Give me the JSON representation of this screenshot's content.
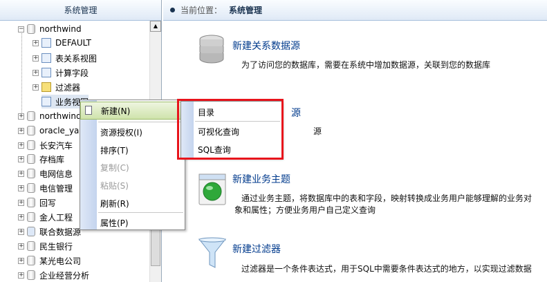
{
  "left_panel": {
    "title": "系统管理"
  },
  "tree": {
    "root_expanded": "northwind",
    "children": [
      "DEFAULT",
      "表关系视图",
      "计算字段",
      "过滤器",
      "业务视图"
    ],
    "databases": [
      "northwind",
      "oracle_ya",
      "长安汽车",
      "存档库",
      "电网信息",
      "电信管理",
      "回写",
      "金人工程",
      "联合数据源",
      "民生银行",
      "某光电公司",
      "企业经营分析"
    ]
  },
  "breadcrumb": {
    "label": "当前位置：",
    "value": "系统管理"
  },
  "items": [
    {
      "title": "新建关系数据源",
      "desc": "为了访问您的数据库，需要在系统中增加数据源，关联到您的数据库"
    },
    {
      "title": "源",
      "desc": "源"
    },
    {
      "title": "新建业务主题",
      "desc1": "通过业务主题，将数据库中的表和字段，映射转换成业务用户能够理解的业务对",
      "desc2": "象和属性；方便业务用户自己定义查询"
    },
    {
      "title": "新建过滤器",
      "desc": "过滤器是一个条件表达式，用于SQL中需要条件表达式的地方，以实现过滤数据"
    }
  ],
  "context_menu": {
    "items": [
      "新建(N)",
      "资源授权(I)",
      "排序(T)",
      "复制(C)",
      "粘贴(S)",
      "刷新(R)",
      "属性(P)"
    ]
  },
  "sub_menu": {
    "items": [
      "目录",
      "可视化查询",
      "SQL查询"
    ]
  },
  "colors": {
    "highlight_border": "#e8141c",
    "title_blue": "#003a8c"
  }
}
